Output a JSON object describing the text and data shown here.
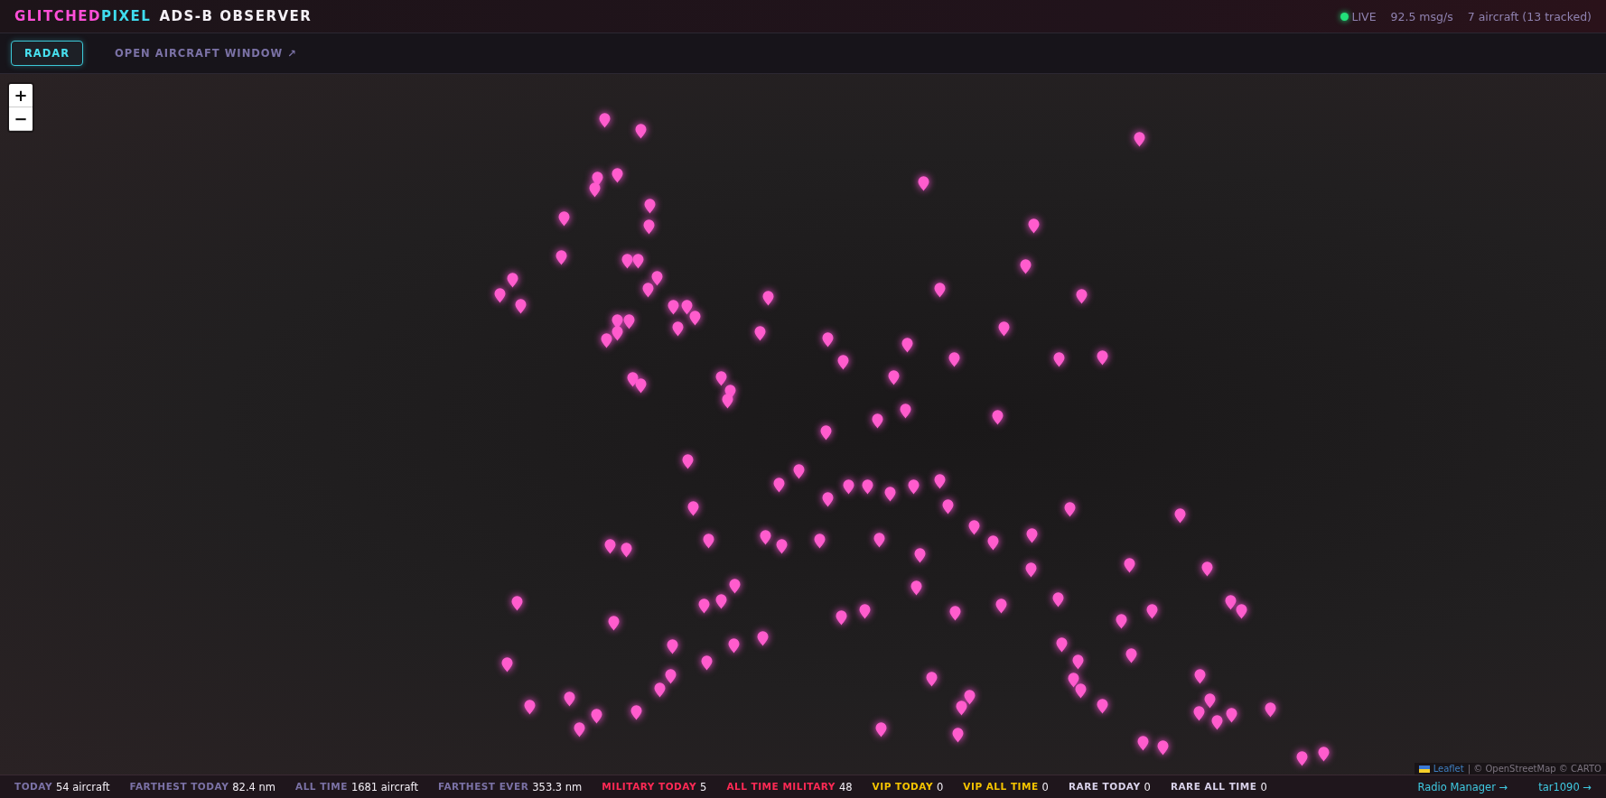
{
  "header": {
    "brand": [
      {
        "text": "GLITCHED",
        "color": "#ff4fd8"
      },
      {
        "text": "PIXEL",
        "color": "#3fdcef"
      }
    ],
    "title": "ADS-B OBSERVER",
    "status": {
      "live": true,
      "live_label": "LIVE",
      "rate": "92.5 msg/s",
      "aircraft": "7 aircraft (13 tracked)"
    }
  },
  "tabs": [
    {
      "label": "RADAR",
      "selected": true
    },
    {
      "label": "OPEN AIRCRAFT WINDOW ↗",
      "selected": false
    }
  ],
  "map": {
    "zoom_controls": [
      "+",
      "−"
    ],
    "attribution": {
      "link": "Leaflet",
      "text": "| © OpenStreetMap © CARTO"
    }
  },
  "footer": {
    "stats": [
      {
        "label": "TODAY",
        "value": "54 aircraft",
        "kind": "normal"
      },
      {
        "label": "FARTHEST TODAY",
        "value": "82.4 nm",
        "kind": "normal"
      },
      {
        "label": "ALL TIME",
        "value": "1681 aircraft",
        "kind": "normal"
      },
      {
        "label": "FARTHEST EVER",
        "value": "353.3 nm",
        "kind": "normal"
      },
      {
        "label": "MILITARY TODAY",
        "value": "5",
        "kind": "military"
      },
      {
        "label": "ALL TIME MILITARY",
        "value": "48",
        "kind": "military"
      },
      {
        "label": "VIP TODAY",
        "value": "0",
        "kind": "vip"
      },
      {
        "label": "VIP ALL TIME",
        "value": "0",
        "kind": "vip"
      },
      {
        "label": "RARE TODAY",
        "value": "0",
        "kind": "rare"
      },
      {
        "label": "RARE ALL TIME",
        "value": "0",
        "kind": "rare"
      }
    ],
    "links": [
      "Radio Manager →",
      "tar1090 →"
    ]
  }
}
